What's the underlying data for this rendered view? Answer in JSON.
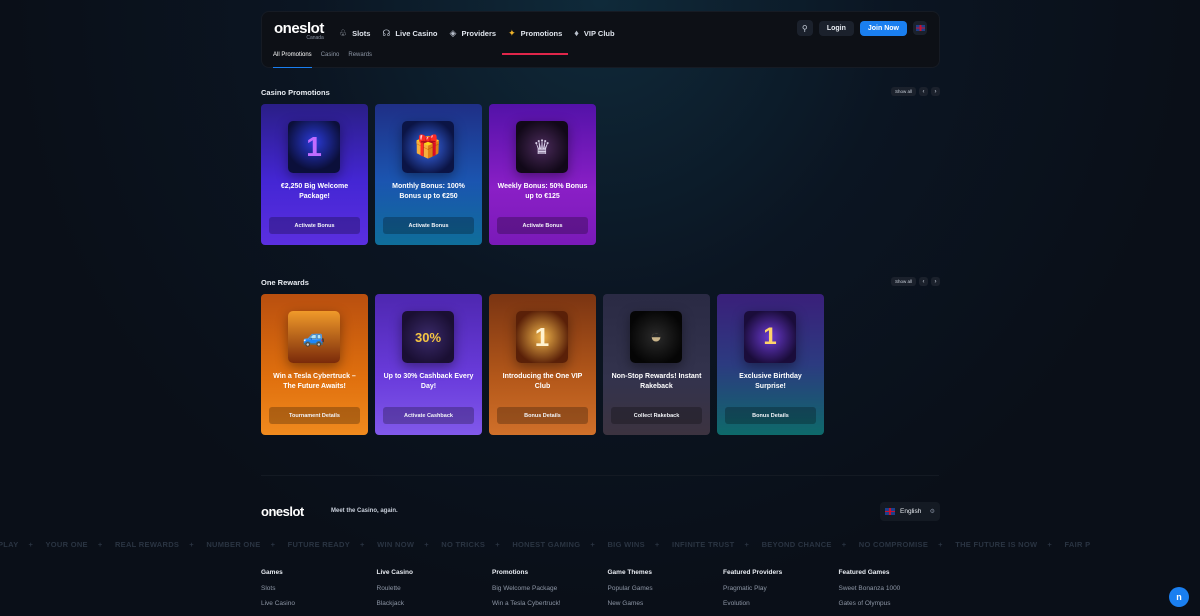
{
  "header": {
    "logo": "oneslot",
    "logo_sub": "Canada",
    "nav": [
      {
        "label": "Slots",
        "icon": "slots-icon"
      },
      {
        "label": "Live Casino",
        "icon": "headset-icon"
      },
      {
        "label": "Providers",
        "icon": "layers-icon"
      },
      {
        "label": "Promotions",
        "icon": "gift-icon"
      },
      {
        "label": "VIP Club",
        "icon": "diamond-icon"
      }
    ],
    "login": "Login",
    "join": "Join Now",
    "subnav": [
      "All Promotions",
      "Casino",
      "Rewards"
    ]
  },
  "casino_promos": {
    "title": "Casino Promotions",
    "show_all": "Show all",
    "cards": [
      {
        "title": "€2,250 Big Welcome Package!",
        "cta": "Activate Bonus"
      },
      {
        "title": "Monthly Bonus: 100% Bonus up to €250",
        "cta": "Activate Bonus"
      },
      {
        "title": "Weekly Bonus: 50% Bonus up to €125",
        "cta": "Activate Bonus"
      }
    ]
  },
  "one_rewards": {
    "title": "One Rewards",
    "show_all": "Show all",
    "cards": [
      {
        "title": "Win a Tesla Cybertruck – The Future Awaits!",
        "cta": "Tournament Details"
      },
      {
        "title": "Up to 30% Cashback Every Day!",
        "cta": "Activate Cashback"
      },
      {
        "title": "Introducing the One VIP Club",
        "cta": "Bonus Details"
      },
      {
        "title": "Non-Stop Rewards! Instant Rakeback",
        "cta": "Collect Rakeback"
      },
      {
        "title": "Exclusive Birthday Surprise!",
        "cta": "Bonus Details"
      }
    ]
  },
  "footer": {
    "logo": "oneslot",
    "tagline": "Meet the Casino, again.",
    "language": "English",
    "ticker": [
      "PLAY",
      "YOUR ONE",
      "REAL REWARDS",
      "NUMBER ONE",
      "FUTURE READY",
      "WIN NOW",
      "NO TRICKS",
      "HONEST GAMING",
      "BIG WINS",
      "INFINITE TRUST",
      "BEYOND CHANCE",
      "NO COMPROMISE",
      "THE FUTURE IS NOW",
      "FAIR P"
    ],
    "columns": [
      {
        "heading": "Games",
        "links": [
          "Slots",
          "Live Casino"
        ]
      },
      {
        "heading": "Live Casino",
        "links": [
          "Roulette",
          "Blackjack"
        ]
      },
      {
        "heading": "Promotions",
        "links": [
          "Big Welcome Package",
          "Win a Tesla Cybertruck!"
        ]
      },
      {
        "heading": "Game Themes",
        "links": [
          "Popular Games",
          "New Games"
        ]
      },
      {
        "heading": "Featured Providers",
        "links": [
          "Pragmatic Play",
          "Evolution"
        ]
      },
      {
        "heading": "Featured Games",
        "links": [
          "Sweet Bonanza 1000",
          "Gates of Olympus"
        ]
      }
    ]
  }
}
